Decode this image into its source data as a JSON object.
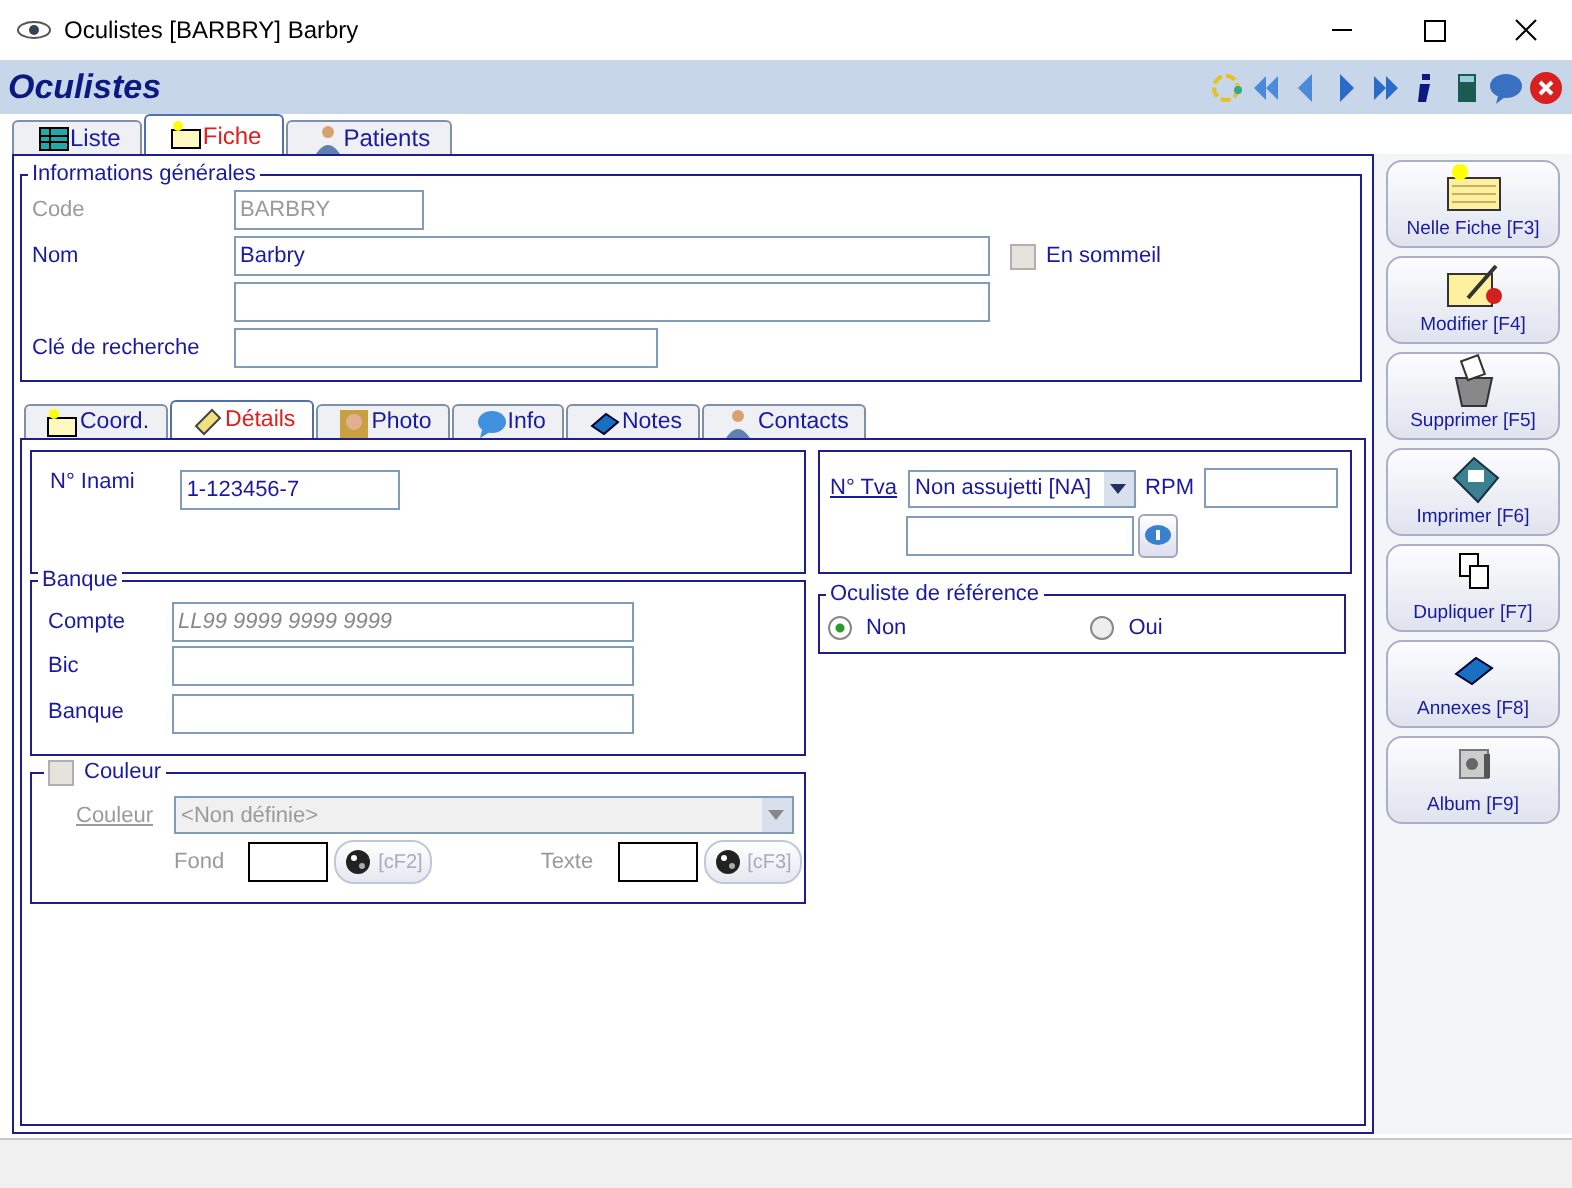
{
  "window": {
    "title": "Oculistes  [BARBRY] Barbry"
  },
  "header": {
    "title": "Oculistes"
  },
  "tabs": [
    {
      "label": "Liste",
      "selected": false
    },
    {
      "label": "Fiche",
      "selected": true
    },
    {
      "label": "Patients",
      "selected": false
    }
  ],
  "general": {
    "legend": "Informations générales",
    "code": {
      "label": "Code",
      "value": "BARBRY",
      "disabled": true
    },
    "nom": {
      "label": "Nom",
      "value": "Barbry"
    },
    "cle": {
      "label": "Clé de recherche"
    },
    "sleep": {
      "label": "En sommeil",
      "checked": false
    }
  },
  "subtabs": [
    {
      "label": "Coord.",
      "selected": false
    },
    {
      "label": "Détails",
      "selected": true
    },
    {
      "label": "Photo",
      "selected": false
    },
    {
      "label": "Info",
      "selected": false
    },
    {
      "label": "Notes",
      "selected": false
    },
    {
      "label": "Contacts",
      "selected": false
    }
  ],
  "inami": {
    "label": "N° Inami",
    "value": "1-123456-7"
  },
  "tva": {
    "label": "N° Tva",
    "select": "Non assujetti [NA]",
    "rpm_label": "RPM"
  },
  "banque": {
    "legend": "Banque",
    "fields": [
      {
        "label": "Compte",
        "placeholder": "LL99 9999 9999 9999"
      },
      {
        "label": "Bic"
      },
      {
        "label": "Banque"
      }
    ]
  },
  "reference": {
    "legend": "Oculiste de référence",
    "options": [
      {
        "label": "Non",
        "selected": true
      },
      {
        "label": "Oui",
        "selected": false
      }
    ]
  },
  "couleur": {
    "legend": "Couleur",
    "checked": false,
    "disabled": true,
    "select_label": "Couleur",
    "select": "<Non définie>",
    "fond_label": "Fond",
    "fond_button": "[cF2]",
    "texte_label": "Texte",
    "texte_button": "[cF3]"
  },
  "actions": [
    {
      "label": "Nelle Fiche [F3]"
    },
    {
      "label": "Modifier [F4]"
    },
    {
      "label": "Supprimer [F5]"
    },
    {
      "label": "Imprimer [F6]"
    },
    {
      "label": "Dupliquer [F7]"
    },
    {
      "label": "Annexes [F8]"
    },
    {
      "label": "Album [F9]"
    }
  ]
}
